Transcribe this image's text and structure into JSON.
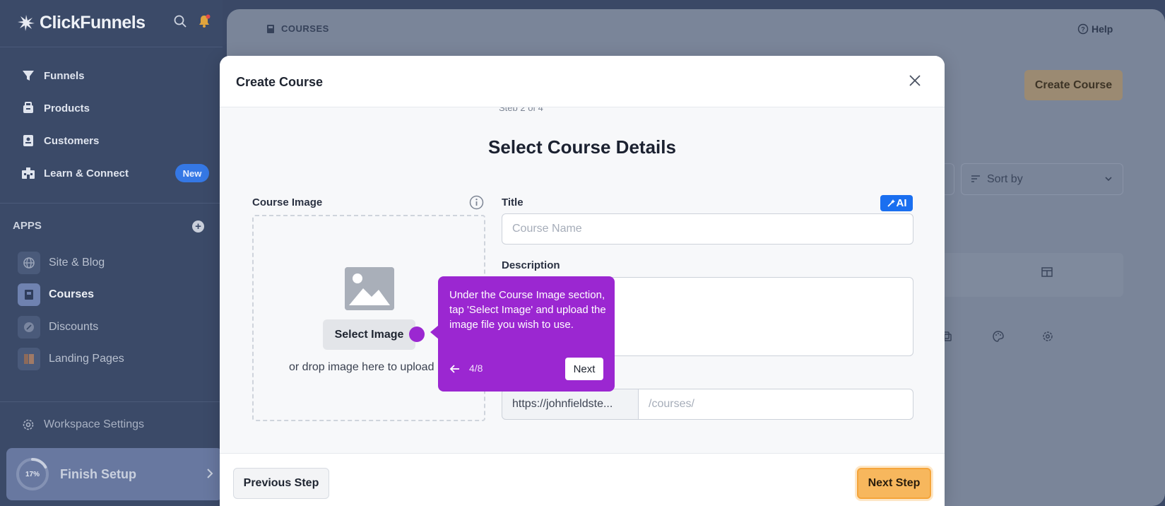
{
  "sidebar": {
    "logo": "ClickFunnels",
    "nav": [
      {
        "label": "Funnels",
        "icon": "funnel-icon"
      },
      {
        "label": "Products",
        "icon": "products-icon"
      },
      {
        "label": "Customers",
        "icon": "customers-icon"
      },
      {
        "label": "Learn & Connect",
        "icon": "learn-connect-icon",
        "badge": "New"
      }
    ],
    "apps_heading": "APPS",
    "apps": [
      {
        "label": "Site & Blog",
        "icon": "site-blog-icon"
      },
      {
        "label": "Courses",
        "icon": "courses-icon",
        "active": true
      },
      {
        "label": "Discounts",
        "icon": "discounts-icon"
      },
      {
        "label": "Landing Pages",
        "icon": "landing-pages-icon"
      }
    ],
    "workspace_settings": "Workspace Settings",
    "finish_setup": {
      "label": "Finish Setup",
      "progress_text": "17%",
      "progress": 0.17
    }
  },
  "main": {
    "breadcrumb": "COURSES",
    "help": "Help",
    "create_course": "Create Course",
    "sort_by": "Sort by"
  },
  "modal": {
    "title": "Create Course",
    "stepper_text": "Step 2 of 4",
    "section_title": "Select Course Details",
    "course_image_label": "Course Image",
    "select_image": "Select Image",
    "drop_hint": "or drop image here to upload",
    "title_label": "Title",
    "ai_badge": "AI",
    "title_placeholder": "Course Name",
    "description_label": "Description",
    "url_prefix": "https://johnfieldste...",
    "url_placeholder": "/courses/",
    "prev_step": "Previous Step",
    "next_step": "Next Step"
  },
  "tooltip": {
    "text": "Under the Course Image section, tap 'Select Image' and upload the image file you wish to use.",
    "progress": "4/8",
    "next": "Next"
  },
  "colors": {
    "accent_purple": "#9b27d1",
    "next_step_orange": "#f7b75d",
    "ai_blue": "#1a6ff0",
    "new_badge_blue": "#3578e5"
  }
}
